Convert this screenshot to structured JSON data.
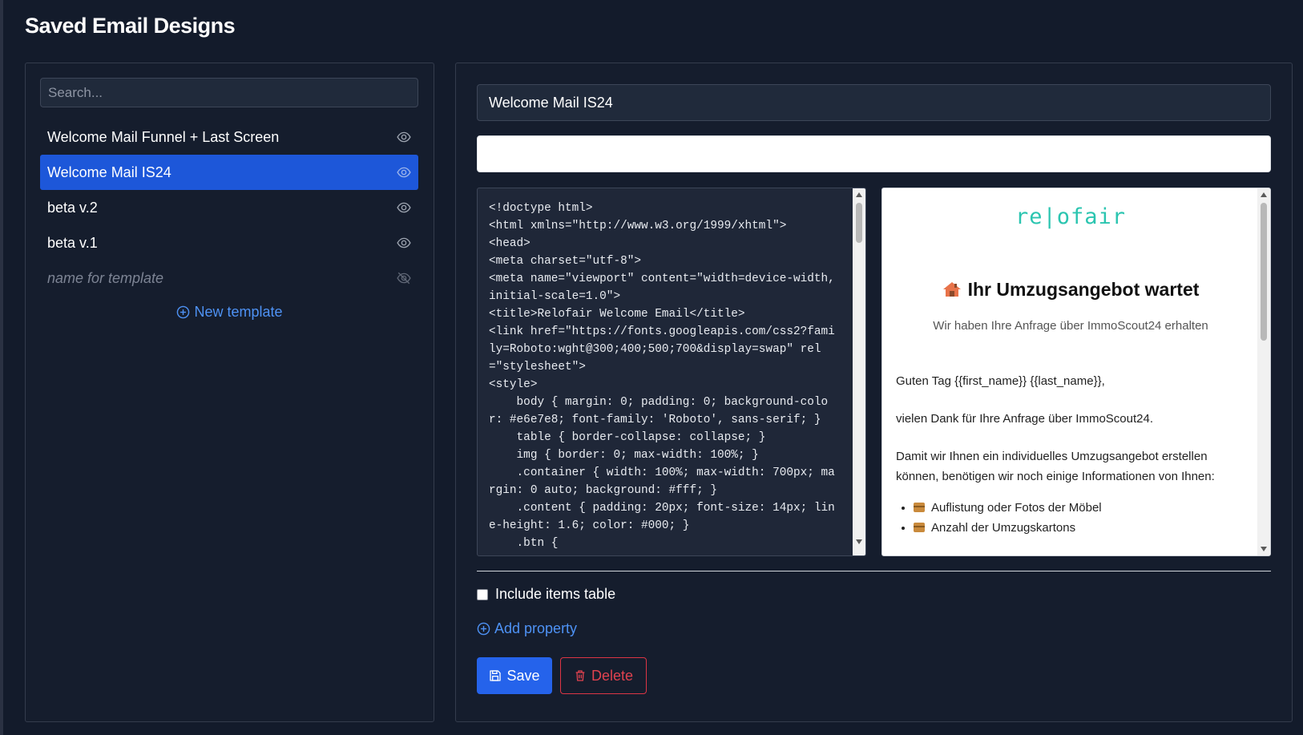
{
  "page": {
    "title": "Saved Email Designs"
  },
  "search": {
    "placeholder": "Search..."
  },
  "templates": [
    {
      "label": "Welcome Mail Funnel + Last Screen",
      "icon": "eye-icon"
    },
    {
      "label": "Welcome Mail IS24",
      "icon": "eye-icon",
      "active": true
    },
    {
      "label": "beta v.2",
      "icon": "eye-icon"
    },
    {
      "label": "beta v.1",
      "icon": "eye-icon"
    },
    {
      "label": "name for template",
      "icon": "eye-off-icon",
      "placeholder": true
    }
  ],
  "new_template_label": "New template",
  "editor": {
    "name_value": "Welcome Mail IS24",
    "subject_value": "",
    "code_lines": [
      "<!doctype html>",
      "<html xmlns=\"http://www.w3.org/1999/xhtml\">",
      "<head>",
      "<meta charset=\"utf-8\">",
      "<meta name=\"viewport\" content=\"width=device-width, initial-scale=1.0\">",
      "<title>Relofair Welcome Email</title>",
      "<link href=\"https://fonts.googleapis.com/css2?family=Roboto:wght@300;400;500;700&display=swap\" rel=\"stylesheet\">",
      "<style>",
      "    body { margin: 0; padding: 0; background-color: #e6e7e8; font-family: 'Roboto', sans-serif; }",
      "    table { border-collapse: collapse; }",
      "    img { border: 0; max-width: 100%; }",
      "    .container { width: 100%; max-width: 700px; margin: 0 auto; background: #fff; }",
      "    .content { padding: 20px; font-size: 14px; line-height: 1.6; color: #000; }",
      "    .btn {"
    ]
  },
  "preview": {
    "logo": "re|ofair",
    "heading": "Ihr Umzugsangebot wartet",
    "subheading": "Wir haben Ihre Anfrage über ImmoScout24 erhalten",
    "greeting": "Guten Tag {{first_name}} {{last_name}},",
    "p1": "vielen Dank für Ihre Anfrage über ImmoScout24.",
    "p2": "Damit wir Ihnen ein individuelles Umzugsangebot erstellen können, benötigen wir noch einige Informationen von Ihnen:",
    "list": [
      "Auflistung oder Fotos der Möbel",
      "Anzahl der Umzugskartons"
    ],
    "colors": {
      "logo": "#2bc5b0"
    }
  },
  "options": {
    "include_items_table": "Include items table"
  },
  "add_property_label": "Add property",
  "buttons": {
    "save": "Save",
    "delete": "Delete"
  },
  "colors": {
    "accent": "#2563eb",
    "danger": "#dc3545",
    "background": "#131b2b"
  }
}
